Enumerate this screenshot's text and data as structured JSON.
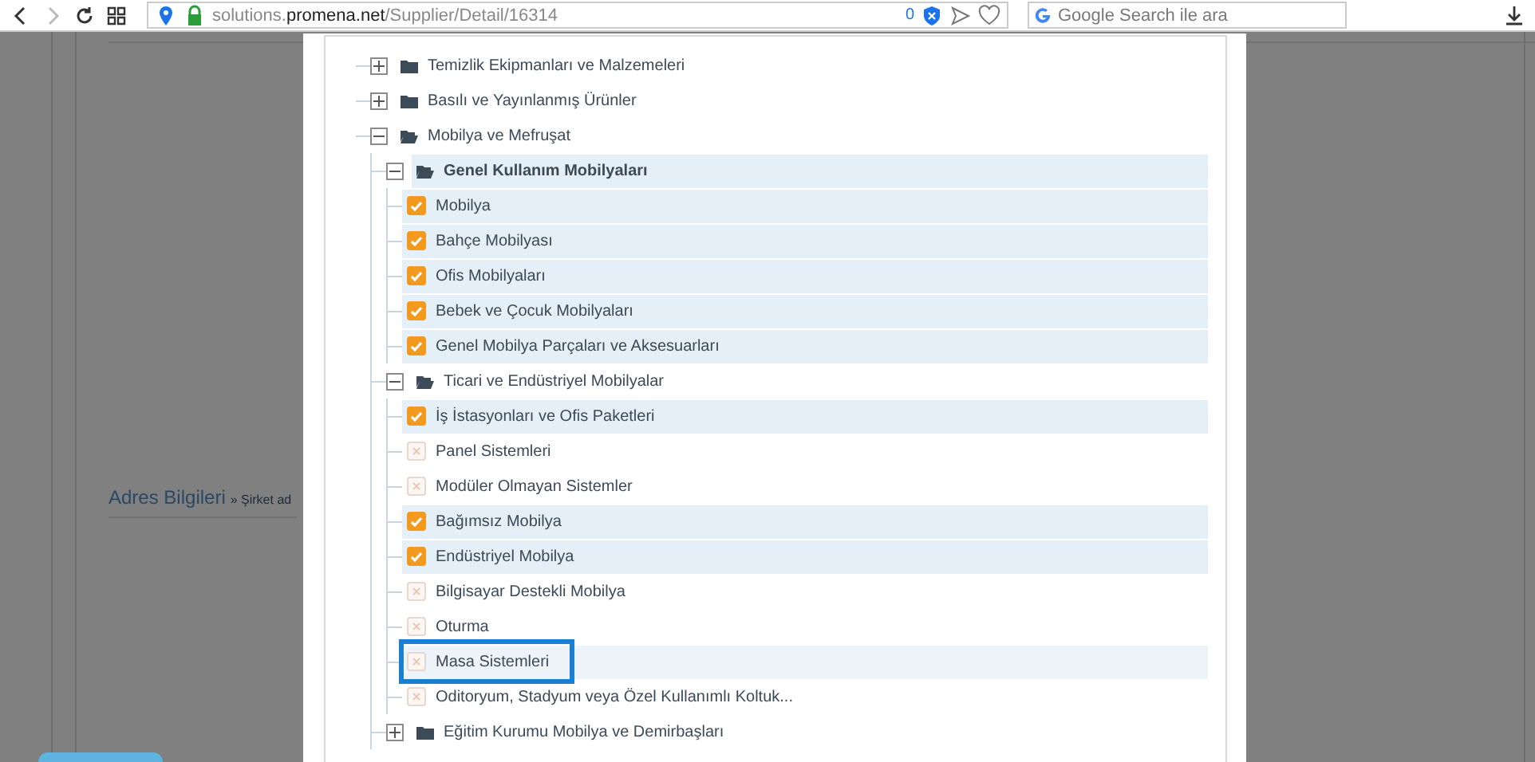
{
  "browser": {
    "url_host": "solutions.",
    "url_domain": "promena.net",
    "url_path": "/Supplier/Detail/16314",
    "badge_count": "0",
    "search": {
      "placeholder": "Google Search ile ara"
    }
  },
  "background": {
    "heading": "Adres Bilgileri",
    "breadcrumb": "» Şirket ad"
  },
  "tree": [
    {
      "label": "Temizlik Ekipmanları ve Malzemeleri",
      "kind": "folder",
      "expanded": false
    },
    {
      "label": "Basılı ve Yayınlanmış Ürünler",
      "kind": "folder",
      "expanded": false
    },
    {
      "label": "Mobilya ve Mefruşat",
      "kind": "folder",
      "expanded": true,
      "children": [
        {
          "label": "Genel Kullanım Mobilyaları",
          "kind": "folder",
          "expanded": true,
          "selected": true,
          "children": [
            {
              "label": "Mobilya",
              "kind": "leaf",
              "checked": true
            },
            {
              "label": "Bahçe Mobilyası",
              "kind": "leaf",
              "checked": true
            },
            {
              "label": "Ofis Mobilyaları",
              "kind": "leaf",
              "checked": true
            },
            {
              "label": "Bebek ve Çocuk Mobilyaları",
              "kind": "leaf",
              "checked": true
            },
            {
              "label": "Genel Mobilya Parçaları ve Aksesuarları",
              "kind": "leaf",
              "checked": true
            }
          ]
        },
        {
          "label": "Ticari ve Endüstriyel Mobilyalar",
          "kind": "folder",
          "expanded": true,
          "selected": false,
          "children": [
            {
              "label": "İş İstasyonları ve Ofis Paketleri",
              "kind": "leaf",
              "checked": true
            },
            {
              "label": "Panel Sistemleri",
              "kind": "leaf",
              "checked": false
            },
            {
              "label": "Modüler Olmayan Sistemler",
              "kind": "leaf",
              "checked": false
            },
            {
              "label": "Bağımsız Mobilya",
              "kind": "leaf",
              "checked": true
            },
            {
              "label": "Endüstriyel Mobilya",
              "kind": "leaf",
              "checked": true
            },
            {
              "label": "Bilgisayar Destekli Mobilya",
              "kind": "leaf",
              "checked": false
            },
            {
              "label": "Oturma",
              "kind": "leaf",
              "checked": false
            },
            {
              "label": "Masa Sistemleri",
              "kind": "leaf",
              "checked": false,
              "hovered": true,
              "annotated": true
            },
            {
              "label": "Oditoryum, Stadyum veya Özel Kullanımlı Koltuk...",
              "kind": "leaf",
              "checked": false
            }
          ]
        },
        {
          "label": "Eğitim Kurumu Mobilya ve Demirbaşları",
          "kind": "folder",
          "expanded": false
        }
      ]
    }
  ]
}
